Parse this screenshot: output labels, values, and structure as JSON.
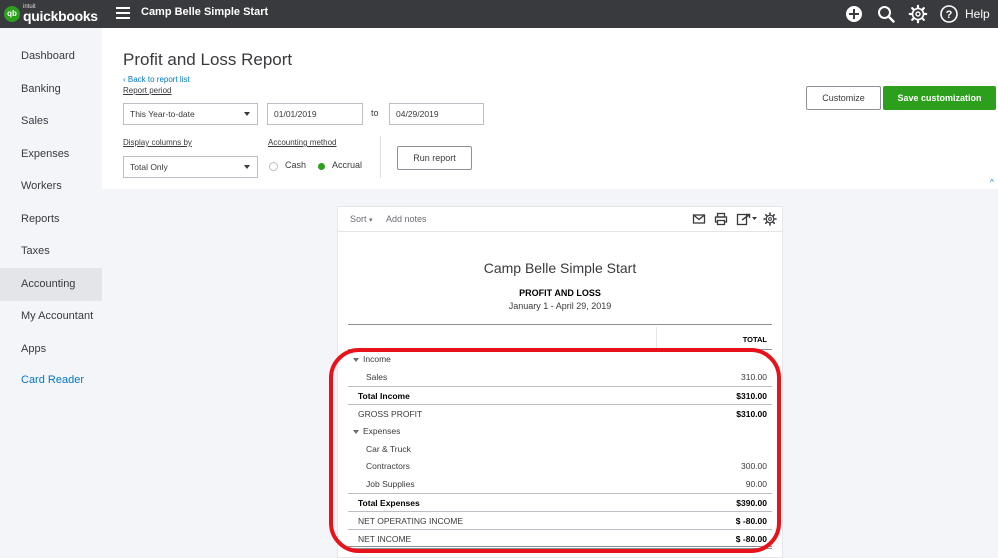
{
  "topbar": {
    "logo_small": "intuit",
    "logo_word": "quickbooks",
    "logo_badge": "qb",
    "company": "Camp Belle Simple Start",
    "help": "Help",
    "icons": [
      "hamburger-icon",
      "plus-icon",
      "search-icon",
      "gear-icon",
      "help-icon"
    ]
  },
  "sidebar": {
    "items": [
      {
        "label": "Dashboard"
      },
      {
        "label": "Banking"
      },
      {
        "label": "Sales"
      },
      {
        "label": "Expenses"
      },
      {
        "label": "Workers"
      },
      {
        "label": "Reports"
      },
      {
        "label": "Taxes"
      },
      {
        "label": "Accounting"
      },
      {
        "label": "My Accountant"
      },
      {
        "label": "Apps"
      },
      {
        "label": "Card Reader"
      }
    ],
    "active": "Accounting"
  },
  "header": {
    "title": "Profit and Loss Report",
    "back_link": "Back to report list",
    "report_period_label": "Report period",
    "period_value": "This Year-to-date",
    "from_date": "01/01/2019",
    "to_label": "to",
    "to_date": "04/29/2019",
    "display_columns_label": "Display columns by",
    "display_columns_value": "Total Only",
    "accounting_method_label": "Accounting method",
    "method_cash": "Cash",
    "method_accrual": "Accrual",
    "selected_method": "Accrual",
    "run_report": "Run report",
    "customize": "Customize",
    "save_customization": "Save customization"
  },
  "report_toolbar": {
    "sort": "Sort",
    "add_notes": "Add notes",
    "icons": [
      "email-icon",
      "print-icon",
      "export-icon",
      "settings-icon"
    ]
  },
  "report": {
    "company": "Camp Belle Simple Start",
    "title": "PROFIT AND LOSS",
    "dates": "January 1 - April 29, 2019",
    "column_header": "TOTAL",
    "rows": [
      {
        "label": "Income",
        "amount": ""
      },
      {
        "label": "Sales",
        "amount": "310.00"
      },
      {
        "label": "Total Income",
        "amount": "$310.00"
      },
      {
        "label": "GROSS PROFIT",
        "amount": "$310.00"
      },
      {
        "label": "Expenses",
        "amount": ""
      },
      {
        "label": "Car & Truck",
        "amount": ""
      },
      {
        "label": "Contractors",
        "amount": "300.00"
      },
      {
        "label": "Job Supplies",
        "amount": "90.00"
      },
      {
        "label": "Total Expenses",
        "amount": "$390.00"
      },
      {
        "label": "NET OPERATING INCOME",
        "amount": "$ -80.00"
      },
      {
        "label": "NET INCOME",
        "amount": "$ -80.00"
      }
    ]
  },
  "colors": {
    "topbar": "#393a3d",
    "brand_green": "#2ca01c",
    "link_blue": "#0077c5",
    "highlight_red": "#e8121b"
  }
}
